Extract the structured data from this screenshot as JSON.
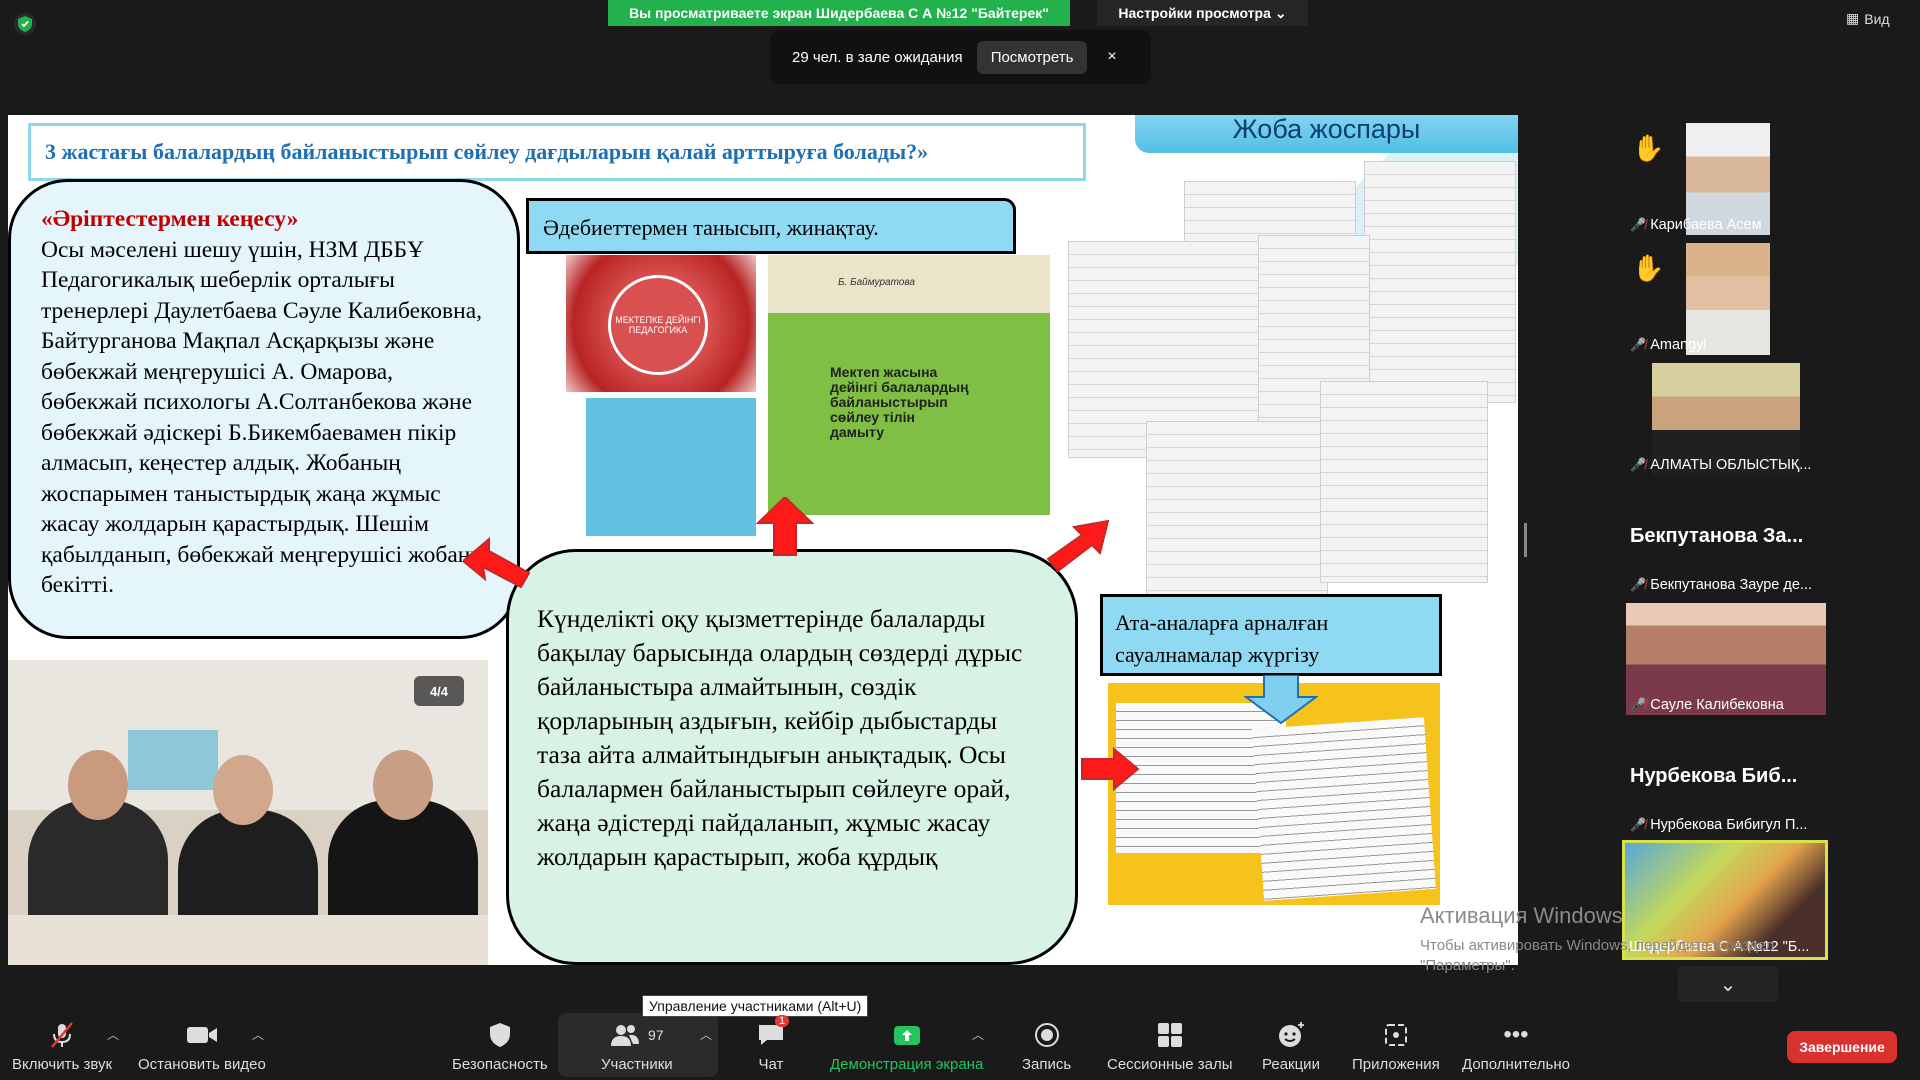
{
  "top": {
    "banner": "Вы просматриваете экран Шидербаева С А №12 \"Байтерек\"",
    "view_settings": "Настройки просмотра",
    "view_button": "Вид",
    "waiting_text": "29 чел. в зале ожидания",
    "waiting_view": "Посмотреть",
    "waiting_close": "×"
  },
  "slide": {
    "title": "3 жастағы балалардың байланыстырып сөйлеу дағдыларын қалай арттыруға  болады?»",
    "plan_title": "Жоба жоспары",
    "bubble_left_title": "«Әріптестермен кеңесу»",
    "bubble_left_body": "Осы мәселені шешу үшін, НЗМ ДББҰ Педагогикалық шеберлік орталығы тренерлері Даулетбаева Сәуле Калибековна, Байтурганова Мақпал Асқарқызы және бөбекжай  меңгерушісі А. Омарова, бөбекжай психологы А.Солтанбекова және бөбекжай әдіскері Б.Бикембаевамен пікір алмасып, кеңестер алдық. Жобаның жоспарымен таныстырдық жаңа жұмыс жасау жолдарын қарастырдық.  Шешім қабылданып, бөбекжай меңгерушісі жобаны бекітті.",
    "literature_label": "Әдебиеттермен танысып, жинақтау.",
    "book1_text": "МЕКТЕПКЕ ДЕЙІНГІ ПЕДАГОГИКА",
    "book3_author": "Б. Баймуратова",
    "book3_title": "Мектеп жасына дейінгі балалардың байланыстырып сөйлеу тілін дамыту",
    "parents_label": "Ата-аналарға арналған сауалнамалар жүргізу",
    "bubble_center_body": "Күнделікті оқу қызметтерінде балаларды бақылау барысында олардың   сөздерді дұрыс байланыстыра алмайтынын, сөздік қорларының аздығын, кейбір дыбыстарды таза айта алмайтындығын анықтадық. Осы балалармен байланыстырып сөйлеуге орай,  жаңа әдістерді пайдаланып, жұмыс жасау жолдарын қарастырып, жоба құрдық",
    "photo_badge": "4/4"
  },
  "participants": [
    {
      "name": "Карибаева Асем",
      "hand": true,
      "big": ""
    },
    {
      "name": "Amangyl",
      "hand": true,
      "big": ""
    },
    {
      "name": "АЛМАТЫ ОБЛЫСТЫҚ...",
      "hand": false,
      "big": ""
    },
    {
      "name": "Бекпутанова Зауре де...",
      "hand": false,
      "big": "Бекпутанова За..."
    },
    {
      "name": "Сауле Калибековна",
      "hand": false,
      "big": ""
    },
    {
      "name": "Нурбекова Бибигул П...",
      "hand": false,
      "big": "Нурбекова Биб..."
    },
    {
      "name": "Шидербаева С А №12 \"Б...",
      "hand": false,
      "big": ""
    }
  ],
  "activation": {
    "title": "Активация Windows",
    "line1": "Чтобы активировать Windows, перейдите в раздел",
    "line2": "\"Параметры\"."
  },
  "toolbar": {
    "mute": "Включить звук",
    "video": "Остановить видео",
    "security": "Безопасность",
    "participants": "Участники",
    "participants_count": "97",
    "chat": "Чат",
    "chat_badge": "1",
    "share": "Демонстрация экрана",
    "record": "Запись",
    "rooms": "Сессионные залы",
    "reactions": "Реакции",
    "apps": "Приложения",
    "more": "Дополнительно",
    "end": "Завершение",
    "tooltip": "Управление участниками (Alt+U)"
  },
  "colors": {
    "banner": "#22b14c",
    "share_green": "#22c55e",
    "end_red": "#d9312d",
    "slide_title_blue": "#1f6fb3"
  }
}
